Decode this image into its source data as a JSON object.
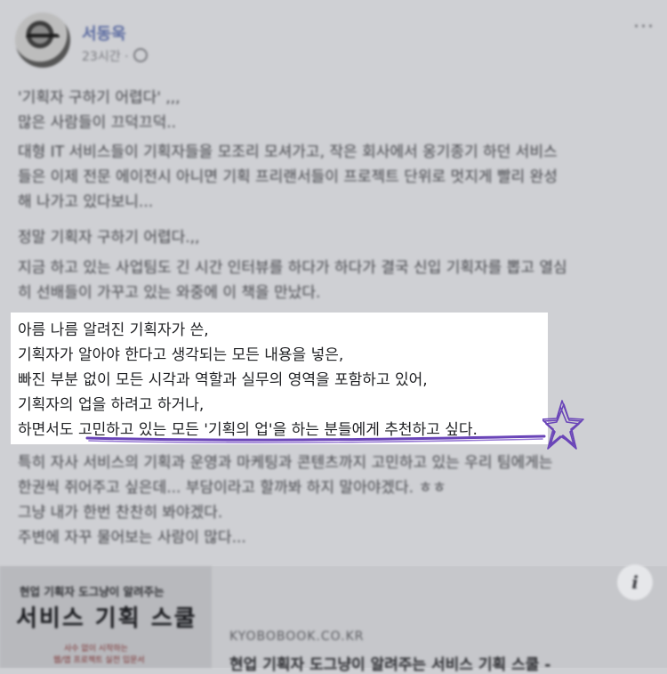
{
  "post": {
    "author": "서동욱",
    "time": "23시간 ·",
    "more": "···",
    "paragraphs": [
      "'기획자 구하기 어렵다' ,,,\n많은 사람들이 끄덕끄덕..",
      "대형 IT 서비스들이 기획자들을 모조리 모셔가고, 작은 회사에서 옹기종기 하던 서비스\n들은 이제 전문 에이전시 아니면 기획 프리랜서들이 프로젝트 단위로 멋지게 빨리 완성\n해 나가고 있다보니...",
      "정말 기획자 구하기 어렵다.,,",
      "지금 하고 있는 사업팀도 긴 시간 인터뷰를 하다가 하다가 결국 신입 기획자를 뽑고 열심\n히 선배들이 가꾸고 있는 와중에 이 책을 만났다.",
      "특히 자사 서비스의 기획과 운영과 마케팅과 콘텐츠까지 고민하고 있는 우리 팀에게는\n한권씩 쥐어주고 싶은데... 부담이라고 할까봐 하지 말아야겠다. ㅎㅎ\n그냥 내가 한번 찬찬히 봐야겠다.\n주변에 자꾸 물어보는 사람이 많다..."
    ],
    "highlight": [
      "아름 나름 알려진 기획자가 쓴,",
      "기획자가 알아야 한다고 생각되는 모든 내용을 넣은,",
      "빠진 부분 없이 모든 시각과 역할과 실무의 영역을 포함하고 있어,",
      "기획자의 업을 하려고 하거나,",
      "하면서도 고민하고 있는 모든 '기획의 업'을 하는 분들에게 추천하고 싶다."
    ]
  },
  "link_card": {
    "book_subtitle": "현업 기획자 도그냥이 알려주는",
    "book_title": "서비스 기획 스쿨",
    "book_tag1": "사수 없이 시작하는",
    "book_tag2": "웹/앱 프로젝트 실전 입문서",
    "domain": "KYOBOBOOK.CO.KR",
    "title": "현업 기획자 도그냥이 알려주는 서비스 기획 스쿨 -",
    "info_icon": "i"
  },
  "colors": {
    "background": "#cfd0d4",
    "highlight_background": "#ffffff",
    "pen_underline": "#6a45b8",
    "author_link": "#5a6aa0"
  }
}
